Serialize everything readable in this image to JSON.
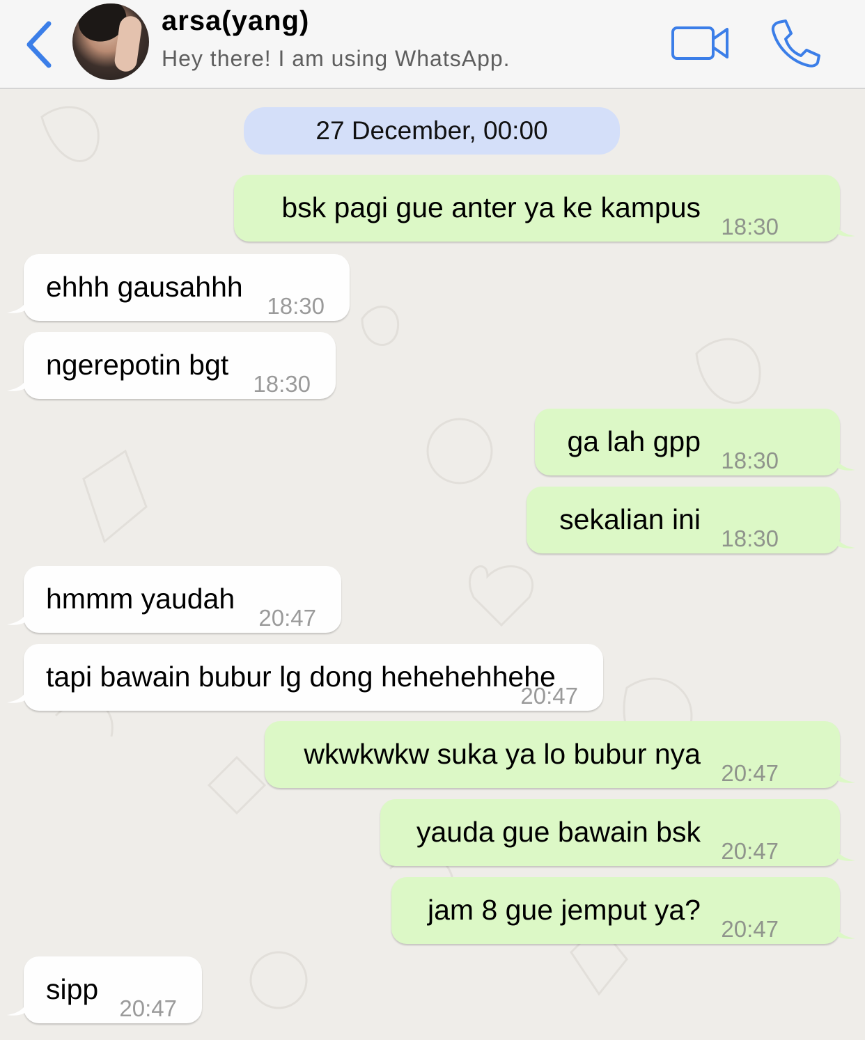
{
  "header": {
    "title": "arsa(yang)",
    "status": "Hey there! I am using WhatsApp.",
    "back_icon": "chevron-left-icon",
    "video_icon": "video-camera-icon",
    "call_icon": "phone-icon",
    "accent_color": "#3b7ee8"
  },
  "chat": {
    "date_label": "27 December, 00:00",
    "colors": {
      "outgoing": "#dcf8c6",
      "incoming": "#fefefe",
      "date_pill": "#d4dff9"
    },
    "messages": [
      {
        "dir": "out",
        "text": "bsk pagi gue anter ya ke kampus",
        "time": "18:30"
      },
      {
        "dir": "in",
        "text": "ehhh gausahhh",
        "time": "18:30"
      },
      {
        "dir": "in",
        "text": "ngerepotin bgt",
        "time": "18:30"
      },
      {
        "dir": "out",
        "text": "ga lah gpp",
        "time": "18:30"
      },
      {
        "dir": "out",
        "text": "sekalian ini",
        "time": "18:30"
      },
      {
        "dir": "in",
        "text": "hmmm yaudah",
        "time": "20:47"
      },
      {
        "dir": "in",
        "text": "tapi bawain bubur lg dong hehehehhehe",
        "time": "20:47"
      },
      {
        "dir": "out",
        "text": "wkwkwkw suka ya lo bubur nya",
        "time": "20:47"
      },
      {
        "dir": "out",
        "text": "yauda gue bawain bsk",
        "time": "20:47"
      },
      {
        "dir": "out",
        "text": "jam 8 gue jemput ya?",
        "time": "20:47"
      },
      {
        "dir": "in",
        "text": "sipp",
        "time": "20:47"
      }
    ]
  }
}
